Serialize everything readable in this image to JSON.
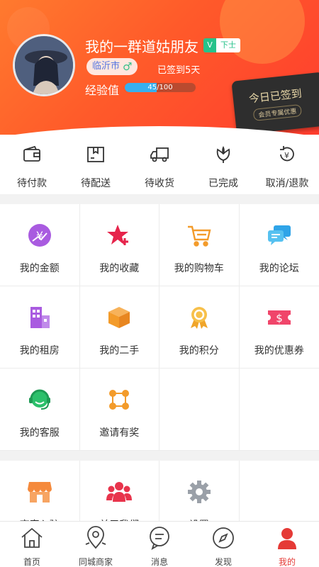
{
  "profile": {
    "username": "我的一群道姑朋友",
    "vip_badge": "V",
    "vip_level": "下士",
    "city": "临沂市",
    "gender_symbol": "♂",
    "signed_days": "已签到5天",
    "exp_label": "经验值",
    "exp_value": "45/100",
    "exp_progress": 0.45
  },
  "sign_card": {
    "title": "今日已签到",
    "subtitle": "会员专属优惠"
  },
  "orders": [
    {
      "label": "待付款",
      "icon": "wallet-icon"
    },
    {
      "label": "待配送",
      "icon": "package-icon"
    },
    {
      "label": "待收货",
      "icon": "truck-icon"
    },
    {
      "label": "已完成",
      "icon": "flower-icon"
    },
    {
      "label": "取消/退款",
      "icon": "refund-icon"
    }
  ],
  "menu": [
    {
      "label": "我的金额",
      "icon": "money-icon"
    },
    {
      "label": "我的收藏",
      "icon": "star-icon"
    },
    {
      "label": "我的购物车",
      "icon": "cart-icon"
    },
    {
      "label": "我的论坛",
      "icon": "chat-icon"
    },
    {
      "label": "我的租房",
      "icon": "building-icon"
    },
    {
      "label": "我的二手",
      "icon": "box-icon"
    },
    {
      "label": "我的积分",
      "icon": "medal-icon"
    },
    {
      "label": "我的优惠券",
      "icon": "coupon-icon"
    },
    {
      "label": "我的客服",
      "icon": "headset-icon"
    },
    {
      "label": "邀请有奖",
      "icon": "network-icon"
    }
  ],
  "menu2": [
    {
      "label": "商家入驻",
      "icon": "shop-icon"
    },
    {
      "label": "关于我们",
      "icon": "people-icon"
    },
    {
      "label": "设置",
      "icon": "gear-icon"
    }
  ],
  "tabs": [
    {
      "label": "首页",
      "icon": "home-icon"
    },
    {
      "label": "同城商家",
      "icon": "map-pin-icon"
    },
    {
      "label": "消息",
      "icon": "message-icon"
    },
    {
      "label": "发现",
      "icon": "compass-icon"
    },
    {
      "label": "我的",
      "icon": "user-icon",
      "active": true
    }
  ],
  "colors": {
    "header": "#ff5a2a",
    "active_tab": "#e53a36",
    "vip": "#27c28a"
  }
}
